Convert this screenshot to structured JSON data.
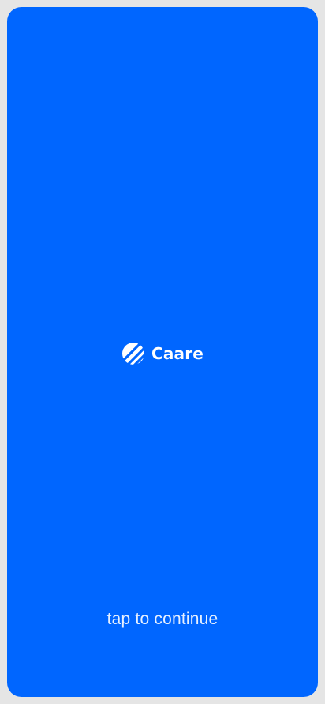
{
  "app": {
    "brand_name": "Caare",
    "logo_icon": "caare-logo-icon",
    "cta_text": "tap to continue"
  },
  "colors": {
    "background": "#0066FF",
    "frame": "#E5E5E5",
    "text": "#FFFFFF"
  }
}
